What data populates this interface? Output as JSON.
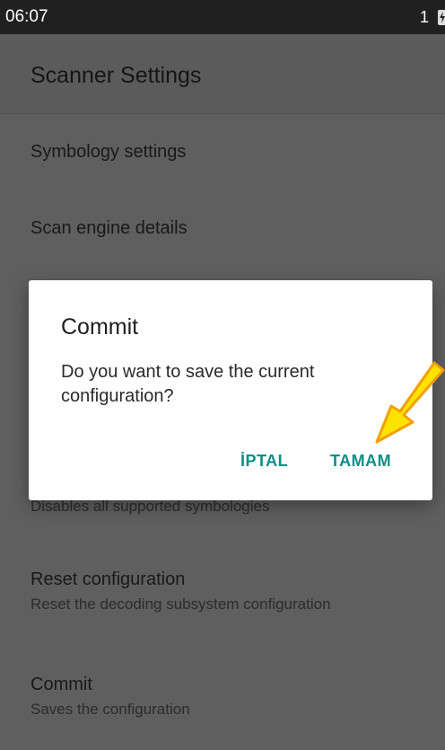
{
  "status_bar": {
    "time": "06:07",
    "notification_count": "1",
    "battery_icon": "battery-charging-icon"
  },
  "app_bar": {
    "title": "Scanner Settings"
  },
  "settings": {
    "symbology": {
      "title": "Symbology settings"
    },
    "scan_engine": {
      "title": "Scan engine details"
    },
    "disable_all": {
      "subtitle": "Disables all supported symbologies"
    },
    "reset": {
      "title": "Reset configuration",
      "subtitle": "Reset the decoding subsystem configuration"
    },
    "commit": {
      "title": "Commit",
      "subtitle": "Saves the configuration"
    }
  },
  "dialog": {
    "title": "Commit",
    "message": "Do you want to save the current configuration?",
    "cancel_label": "İPTAL",
    "ok_label": "TAMAM"
  },
  "colors": {
    "accent": "#0b8f86",
    "arrow": "#ffe300",
    "arrow_outline": "#f2a000",
    "scrim_bg": "#5f5f5f",
    "status_bar": "#202020"
  }
}
